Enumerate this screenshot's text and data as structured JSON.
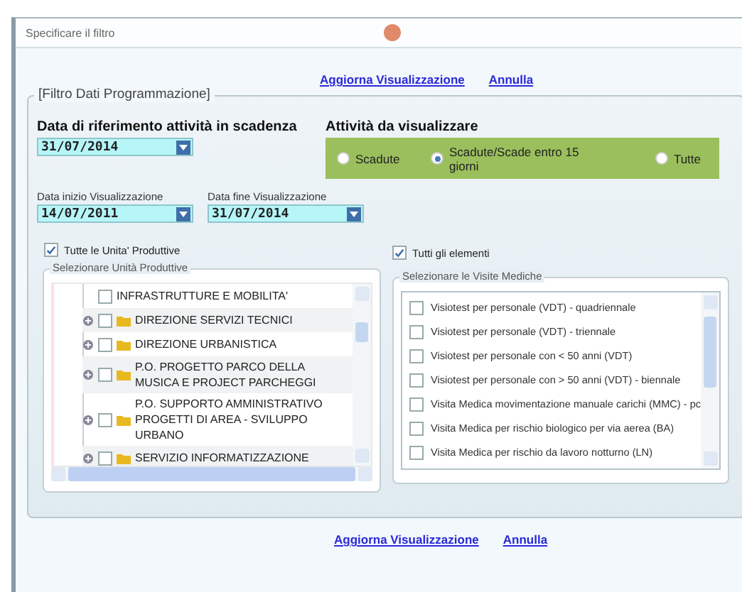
{
  "window": {
    "title": "Specificare il filtro"
  },
  "top_links": [
    "Aggiorna Visualizzazione",
    "Annulla"
  ],
  "filter": {
    "legend": "[Filtro Dati Programmazione]",
    "reference_date": {
      "label": "Data di riferimento attività in scadenza",
      "value": "31/07/2014"
    },
    "activities": {
      "label": "Attività da visualizzare",
      "options": [
        {
          "label": "Scadute",
          "selected": false
        },
        {
          "label": "Scadute/Scade entro 15 giorni",
          "selected": true
        },
        {
          "label": "Tutte",
          "selected": false
        }
      ]
    },
    "start_date": {
      "label": "Data inizio Visualizzazione",
      "value": "14/07/2011"
    },
    "end_date": {
      "label": "Data fine Visualizzazione",
      "value": "31/07/2014"
    },
    "all_units": {
      "label": "Tutte le Unita' Produttive",
      "checked": true
    },
    "all_items": {
      "label": "Tutti gli elementi",
      "checked": true
    },
    "units": {
      "legend": "Selezionare Unità Produttive",
      "items": [
        {
          "label": "INFRASTRUTTURE E MOBILITA'",
          "checked": false,
          "kind": "partial"
        },
        {
          "label": "DIREZIONE SERVIZI TECNICI",
          "checked": false,
          "kind": "folder"
        },
        {
          "label": "DIREZIONE URBANISTICA",
          "checked": false,
          "kind": "folder"
        },
        {
          "label": "P.O. PROGETTO PARCO DELLA MUSICA E PROJECT PARCHEGGI",
          "checked": false,
          "kind": "folder"
        },
        {
          "label": "P.O. SUPPORTO AMMINISTRATIVO PROGETTI DI AREA - SVILUPPO URBANO",
          "checked": false,
          "kind": "folder"
        },
        {
          "label": "SERVIZIO INFORMATIZZAZIONE",
          "checked": false,
          "kind": "folder"
        }
      ]
    },
    "visits": {
      "legend": "Selezionare le Visite Mediche",
      "items": [
        {
          "label": "Visiotest per personale (VDT) - quadriennale",
          "checked": false
        },
        {
          "label": "Visiotest per personale (VDT) - triennale",
          "checked": false
        },
        {
          "label": "Visiotest per personale con < 50 anni (VDT)",
          "checked": false
        },
        {
          "label": "Visiotest per personale con > 50 anni (VDT) - biennale",
          "checked": false
        },
        {
          "label": "Visita Medica movimentazione manuale carichi (MMC) - pc",
          "checked": false
        },
        {
          "label": "Visita Medica per rischio biologico per via aerea (BA)",
          "checked": false
        },
        {
          "label": "Visita Medica per rischio da lavoro notturno (LN)",
          "checked": false
        }
      ]
    }
  },
  "bottom_links": [
    "Aggiorna Visualizzazione",
    "Annulla"
  ]
}
